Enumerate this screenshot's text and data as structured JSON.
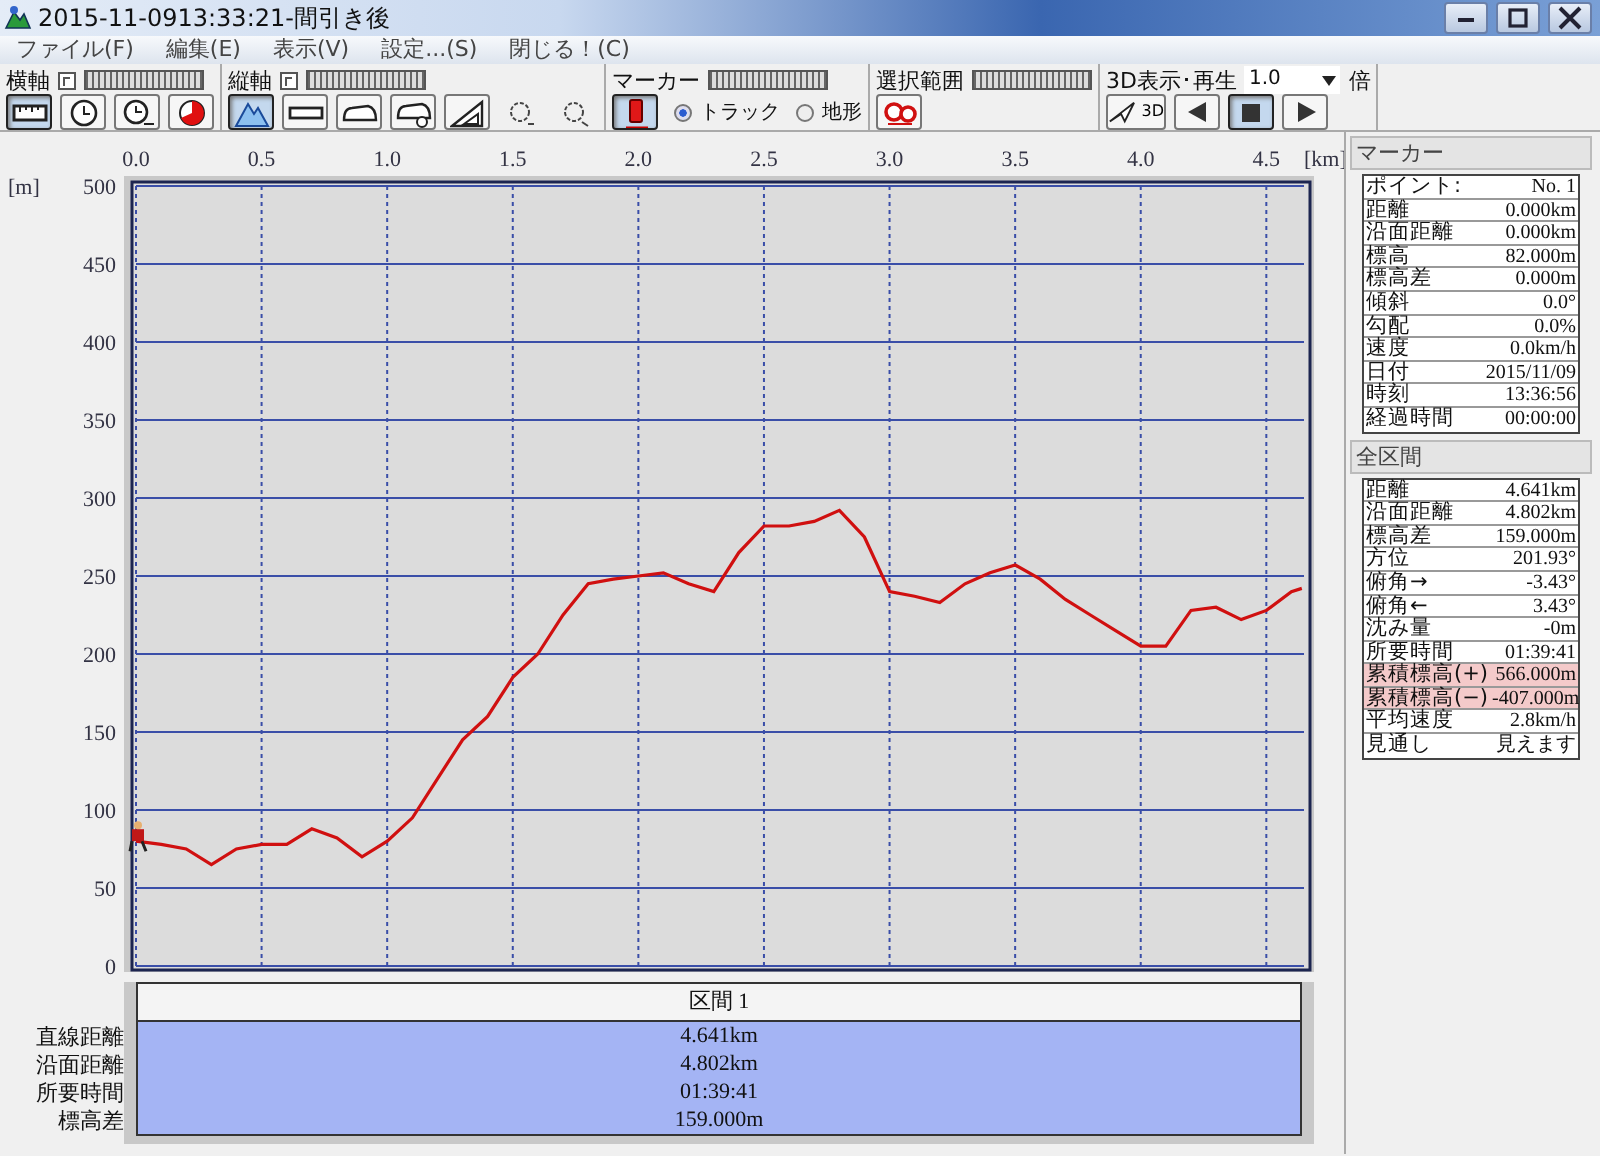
{
  "window": {
    "title": "2015-11-0913:33:21-間引き後"
  },
  "menu": [
    {
      "label": "ファイル(F)"
    },
    {
      "label": "編集(E)"
    },
    {
      "label": "表示(V)"
    },
    {
      "label": "設定...(S)"
    },
    {
      "label": "閉じる！(C)"
    }
  ],
  "toolbar": {
    "groups": [
      {
        "kind": "axis",
        "label": "横軸",
        "buttons": [
          {
            "kind": "ruler",
            "selected": true
          },
          {
            "kind": "clock",
            "selected": false
          },
          {
            "kind": "clock-count",
            "selected": false
          },
          {
            "kind": "pie",
            "selected": false
          }
        ]
      },
      {
        "kind": "axis",
        "label": "縦軸",
        "buttons": [
          {
            "kind": "mountain",
            "selected": true
          },
          {
            "kind": "bar",
            "selected": false
          },
          {
            "kind": "car",
            "selected": false
          },
          {
            "kind": "car-person",
            "selected": false
          },
          {
            "kind": "triangle",
            "selected": false
          },
          {
            "kind": "bulb",
            "selected": false
          },
          {
            "kind": "bulb-plug",
            "selected": false
          }
        ]
      },
      {
        "kind": "marker",
        "label": "マーカー",
        "buttons": [
          {
            "kind": "pin",
            "selected": true
          }
        ],
        "options": [
          {
            "label": "トラック",
            "selected": true
          },
          {
            "label": "地形",
            "selected": false
          }
        ]
      },
      {
        "kind": "plain",
        "label": "選択範囲",
        "buttons": [
          {
            "kind": "glasses",
            "selected": false
          }
        ]
      },
      {
        "kind": "playback",
        "label": "3D表示･再生",
        "speed": "1.0",
        "unit": "倍",
        "buttons": [
          {
            "kind": "plane",
            "label": "3D",
            "selected": false
          },
          {
            "kind": "prev",
            "selected": false
          },
          {
            "kind": "stop",
            "selected": true
          },
          {
            "kind": "next",
            "selected": false
          }
        ]
      }
    ]
  },
  "chart": {
    "chart_data": {
      "type": "line",
      "xlabel": "[km]",
      "ylabel": "[m]",
      "x": [
        0,
        0.1,
        0.2,
        0.3,
        0.4,
        0.5,
        0.6,
        0.7,
        0.8,
        0.9,
        1.0,
        1.1,
        1.2,
        1.3,
        1.4,
        1.5,
        1.6,
        1.7,
        1.8,
        1.9,
        2.0,
        2.1,
        2.2,
        2.3,
        2.4,
        2.5,
        2.6,
        2.7,
        2.8,
        2.9,
        3.0,
        3.1,
        3.2,
        3.3,
        3.4,
        3.5,
        3.6,
        3.7,
        3.8,
        3.9,
        4.0,
        4.1,
        4.2,
        4.3,
        4.4,
        4.5,
        4.6,
        4.641
      ],
      "series": [
        {
          "color": "#d01010",
          "values": [
            80,
            78,
            75,
            65,
            75,
            78,
            78,
            88,
            82,
            70,
            80,
            95,
            120,
            145,
            160,
            185,
            200,
            225,
            245,
            248,
            250,
            252,
            245,
            240,
            265,
            282,
            282,
            285,
            292,
            275,
            240,
            237,
            233,
            245,
            252,
            257,
            248,
            235,
            225,
            215,
            205,
            205,
            228,
            230,
            222,
            228,
            240,
            242
          ]
        }
      ],
      "xlim": [
        0,
        4.65
      ],
      "ylim": [
        0,
        500
      ],
      "xticks": [
        {
          "value": 0,
          "label": "0.0"
        },
        {
          "value": 0.5,
          "label": "0.5"
        },
        {
          "value": 1,
          "label": "1.0"
        },
        {
          "value": 1.5,
          "label": "1.5"
        },
        {
          "value": 2,
          "label": "2.0"
        },
        {
          "value": 2.5,
          "label": "2.5"
        },
        {
          "value": 3,
          "label": "3.0"
        },
        {
          "value": 3.5,
          "label": "3.5"
        },
        {
          "value": 4,
          "label": "4.0"
        },
        {
          "value": 4.5,
          "label": "4.5"
        }
      ],
      "yticks": [
        0,
        50,
        100,
        150,
        200,
        250,
        300,
        350,
        400,
        450,
        500
      ],
      "grid": true
    }
  },
  "section": {
    "header": "区間 1",
    "rows": [
      {
        "label": "直線距離",
        "value": "4.641km"
      },
      {
        "label": "沿面距離",
        "value": "4.802km"
      },
      {
        "label": "所要時間",
        "value": "01:39:41"
      },
      {
        "label": "標高差",
        "value": "159.000m"
      }
    ]
  },
  "marker_panel": {
    "title": "マーカー",
    "rows": [
      {
        "label": "ポイント:",
        "value": "No. 1"
      },
      {
        "label": "距離",
        "value": "0.000km"
      },
      {
        "label": "沿面距離",
        "value": "0.000km"
      },
      {
        "label": "標高",
        "value": "82.000m"
      },
      {
        "label": "標高差",
        "value": "0.000m"
      },
      {
        "label": "傾斜",
        "value": "0.0°"
      },
      {
        "label": "勾配",
        "value": "0.0%"
      },
      {
        "label": "速度",
        "value": "0.0km/h"
      },
      {
        "label": "日付",
        "value": "2015/11/09"
      },
      {
        "label": "時刻",
        "value": "13:36:56"
      },
      {
        "label": "経過時間",
        "value": "00:00:00"
      }
    ]
  },
  "total_panel": {
    "title": "全区間",
    "rows": [
      {
        "label": "距離",
        "value": "4.641km",
        "highlighted": false
      },
      {
        "label": "沿面距離",
        "value": "4.802km",
        "highlighted": false
      },
      {
        "label": "標高差",
        "value": "159.000m",
        "highlighted": false
      },
      {
        "label": "方位",
        "value": "201.93°",
        "highlighted": false
      },
      {
        "label": "俯角→",
        "value": "-3.43°",
        "highlighted": false
      },
      {
        "label": "俯角←",
        "value": "3.43°",
        "highlighted": false
      },
      {
        "label": "沈み量",
        "value": "-0m",
        "highlighted": false
      },
      {
        "label": "所要時間",
        "value": "01:39:41",
        "highlighted": false
      },
      {
        "label": "累積標高(+)",
        "value": "566.000m",
        "highlighted": true
      },
      {
        "label": "累積標高(−)",
        "value": "-407.000m",
        "highlighted": true
      },
      {
        "label": "平均速度",
        "value": "2.8km/h",
        "highlighted": false
      },
      {
        "label": "見通し",
        "value": "見えます",
        "highlighted": false
      }
    ]
  }
}
